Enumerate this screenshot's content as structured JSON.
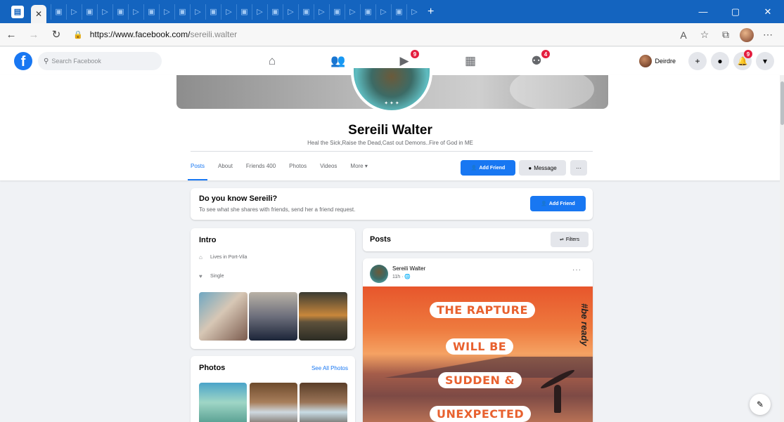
{
  "browser": {
    "tab_icons_count": 24,
    "url_host": "https://www.facebook.com/",
    "url_path": "sereili.walter",
    "window_controls": [
      "—",
      "▢",
      "✕"
    ]
  },
  "fbnav": {
    "search_placeholder": "Search Facebook",
    "user_name": "Deirdre",
    "watch_badge": "9",
    "groups_badge": "4",
    "notifications_badge": "9"
  },
  "profile": {
    "name": "Sereili Walter",
    "bio": "Heal the Sick,Raise the Dead,Cast out Demons..Fire of God in ME",
    "tabs": [
      "Posts",
      "About",
      "Friends 400",
      "Photos",
      "Videos",
      "More ▾"
    ],
    "add_friend_label": "Add Friend",
    "message_label": "Message",
    "more_label": "···"
  },
  "know_card": {
    "title": "Do you know Sereili?",
    "subtitle": "To see what she shares with friends, send her a friend request.",
    "button_label": "Add Friend"
  },
  "intro": {
    "title": "Intro",
    "lives_in": "Lives in Port-Vila",
    "relationship": "Single"
  },
  "photos": {
    "title": "Photos",
    "see_all": "See All Photos"
  },
  "posts": {
    "title": "Posts",
    "filters_label": "Filters",
    "post": {
      "author": "Sereili Walter",
      "meta": "11h · 🌐",
      "image_lines": [
        "THE RAPTURE",
        "WILL BE",
        "SUDDEN &",
        "UNEXPECTED"
      ],
      "hashtag": "#be ready"
    }
  },
  "colors": {
    "facebook_blue": "#1877f2",
    "browser_tab_bar": "#1464bf",
    "badge_red": "#e41e3f",
    "page_background": "#f0f2f5"
  }
}
